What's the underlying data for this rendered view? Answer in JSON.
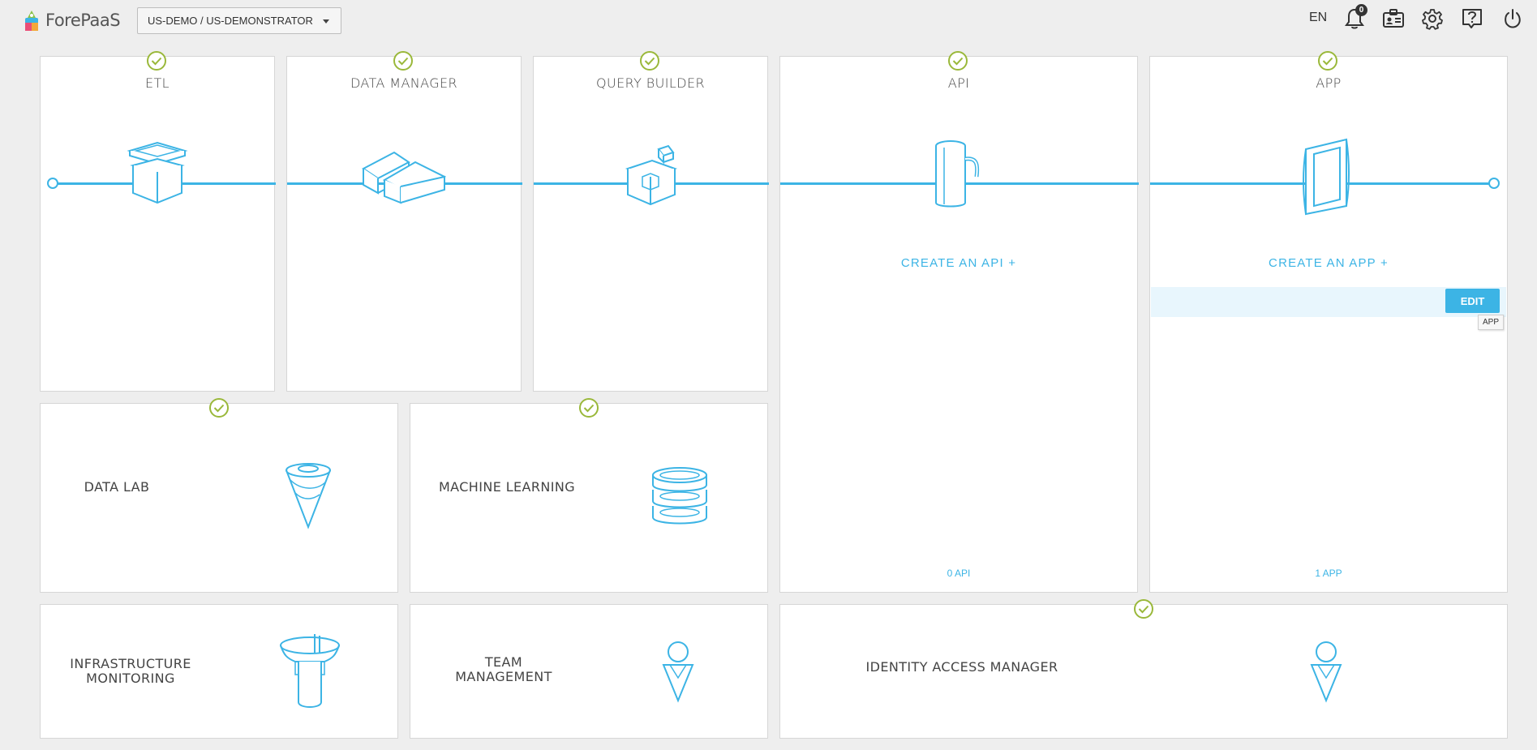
{
  "header": {
    "logo_text": "ForePaaS",
    "project": "US-DEMO / US-DEMONSTRATOR",
    "lang": "EN",
    "notif_count": "0",
    "icons": [
      "bell-icon",
      "id-card-icon",
      "gear-icon",
      "help-icon",
      "power-icon"
    ]
  },
  "colors": {
    "accent": "#3cb4e5",
    "check": "#9ab83a"
  },
  "cards": {
    "etl": {
      "title": "ETL"
    },
    "data_manager": {
      "title": "DATA MANAGER"
    },
    "query_builder": {
      "title": "QUERY BUILDER"
    },
    "api": {
      "title": "API",
      "create": "CREATE AN API  +",
      "count": "0 API"
    },
    "app": {
      "title": "APP",
      "create": "CREATE AN APP  +",
      "count": "1 APP",
      "edit": "EDIT",
      "tooltip": "APP"
    },
    "data_lab": {
      "title": "DATA LAB"
    },
    "machine_learning": {
      "title": "MACHINE LEARNING"
    },
    "infrastructure": {
      "title_line1": "INFRASTRUCTURE",
      "title_line2": "MONITORING"
    },
    "team": {
      "title": "TEAM MANAGEMENT"
    },
    "iam": {
      "title": "IDENTITY ACCESS MANAGER"
    }
  }
}
